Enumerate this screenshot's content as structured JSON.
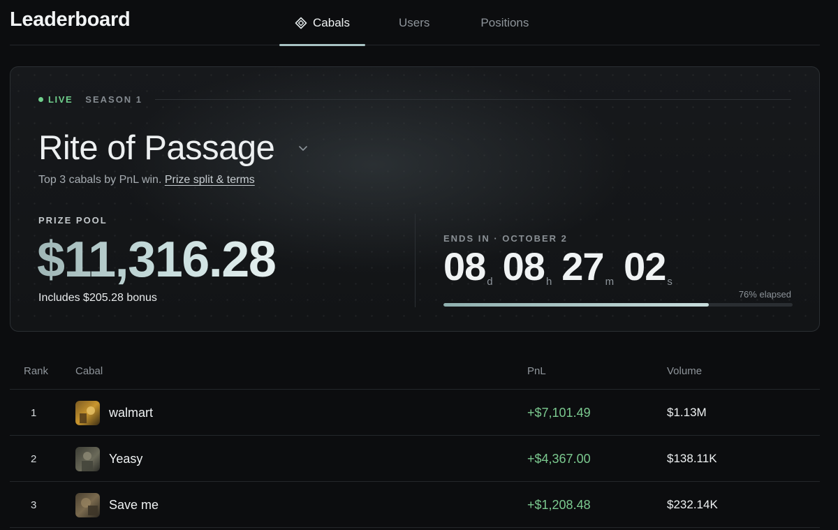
{
  "header": {
    "title": "Leaderboard",
    "tabs": [
      {
        "label": "Cabals",
        "active": true,
        "icon": "cabal-diamond-icon"
      },
      {
        "label": "Users",
        "active": false
      },
      {
        "label": "Positions",
        "active": false
      }
    ]
  },
  "season": {
    "live_label": "LIVE",
    "season_label": "SEASON 1",
    "title": "Rite of Passage",
    "subtitle_text": "Top 3 cabals by PnL win. ",
    "terms_link": "Prize split & terms",
    "prize_label": "PRIZE POOL",
    "prize_value": "$11,316.28",
    "prize_bonus": "Includes $205.28 bonus",
    "ends_label": "ENDS IN · OCTOBER 2",
    "countdown": {
      "days": "08",
      "days_unit": "d",
      "hours": "08",
      "hours_unit": "h",
      "minutes": "27",
      "minutes_unit": "m",
      "seconds": "02",
      "seconds_unit": "s"
    },
    "elapsed_label": "76% elapsed",
    "elapsed_fraction": 0.76
  },
  "table": {
    "columns": [
      "Rank",
      "Cabal",
      "PnL",
      "Volume"
    ],
    "rows": [
      {
        "rank": "1",
        "name": "walmart",
        "pnl": "+$7,101.49",
        "volume": "$1.13M"
      },
      {
        "rank": "2",
        "name": "Yeasy",
        "pnl": "+$4,367.00",
        "volume": "$138.11K"
      },
      {
        "rank": "3",
        "name": "Save me",
        "pnl": "+$1,208.48",
        "volume": "$232.14K"
      }
    ]
  },
  "colors": {
    "accent": "#a9c3c4",
    "live": "#6fcf8c",
    "pnl_positive": "#7bc98f"
  }
}
